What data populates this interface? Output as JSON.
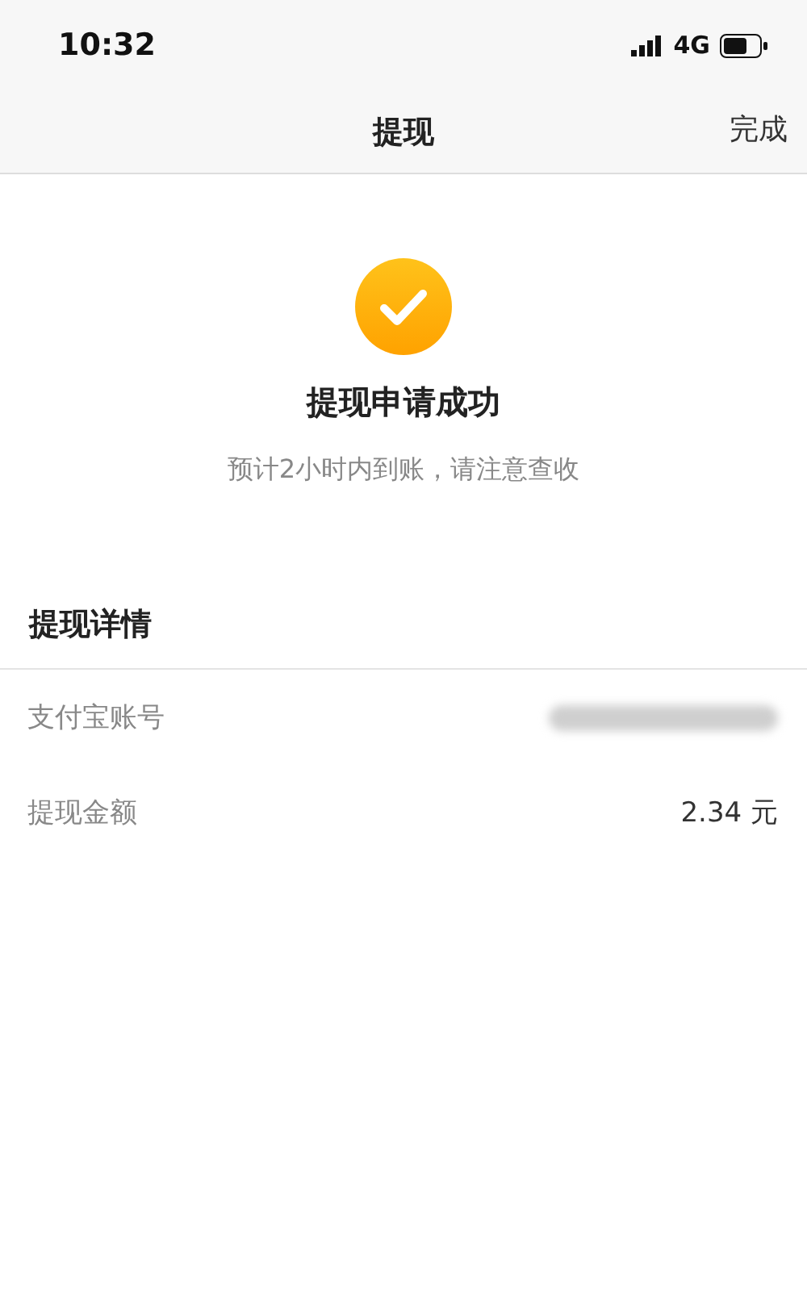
{
  "status_bar": {
    "time": "10:32",
    "network": "4G"
  },
  "nav_bar": {
    "title": "提现",
    "action": "完成"
  },
  "result": {
    "title": "提现申请成功",
    "subtitle": "预计2小时内到账，请注意查收"
  },
  "details": {
    "title": "提现详情",
    "rows": [
      {
        "label": "支付宝账号",
        "kind": "hidden"
      },
      {
        "label": "提现金额",
        "kind": "text",
        "value": "2.34 元"
      }
    ]
  }
}
